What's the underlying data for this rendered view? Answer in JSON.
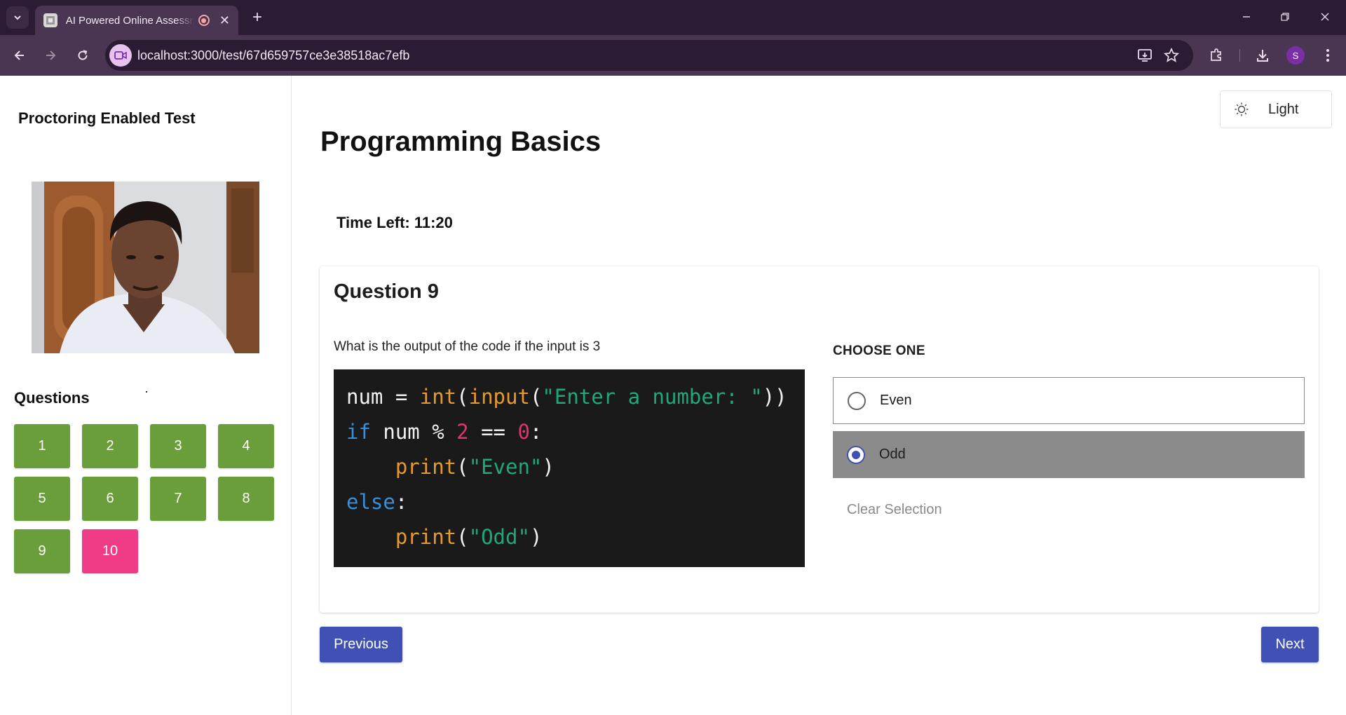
{
  "browser": {
    "tab_title": "AI Powered Online Assessment",
    "url": "localhost:3000/test/67d659757ce3e38518ac7efb",
    "profile_initial": "S"
  },
  "sidebar": {
    "title": "Proctoring Enabled Test",
    "questions_heading": "Questions",
    "question_buttons": [
      {
        "label": "1",
        "status": "answered"
      },
      {
        "label": "2",
        "status": "answered"
      },
      {
        "label": "3",
        "status": "answered"
      },
      {
        "label": "4",
        "status": "answered"
      },
      {
        "label": "5",
        "status": "answered"
      },
      {
        "label": "6",
        "status": "answered"
      },
      {
        "label": "7",
        "status": "answered"
      },
      {
        "label": "8",
        "status": "answered"
      },
      {
        "label": "9",
        "status": "answered"
      },
      {
        "label": "10",
        "status": "unanswered"
      }
    ]
  },
  "header": {
    "theme_label": "Light",
    "page_title": "Programming Basics",
    "time_left": "Time Left: 11:20"
  },
  "question": {
    "heading": "Question 9",
    "text": "What is the output of the code if the input is 3",
    "code_lines": [
      "num = int(input(\"Enter a number: \"))",
      "if num % 2 == 0:",
      "    print(\"Even\")",
      "else:",
      "    print(\"Odd\")"
    ],
    "choose_label": "CHOOSE ONE",
    "options": [
      {
        "label": "Even",
        "selected": false
      },
      {
        "label": "Odd",
        "selected": true
      }
    ],
    "clear_label": "Clear Selection"
  },
  "nav": {
    "previous_label": "Previous",
    "next_label": "Next"
  },
  "colors": {
    "answered": "#6a9e3a",
    "unanswered": "#f03c86",
    "primary": "#3f51b5",
    "selected_option_bg": "#8b8b8b",
    "code_bg": "#1a1a1a"
  }
}
